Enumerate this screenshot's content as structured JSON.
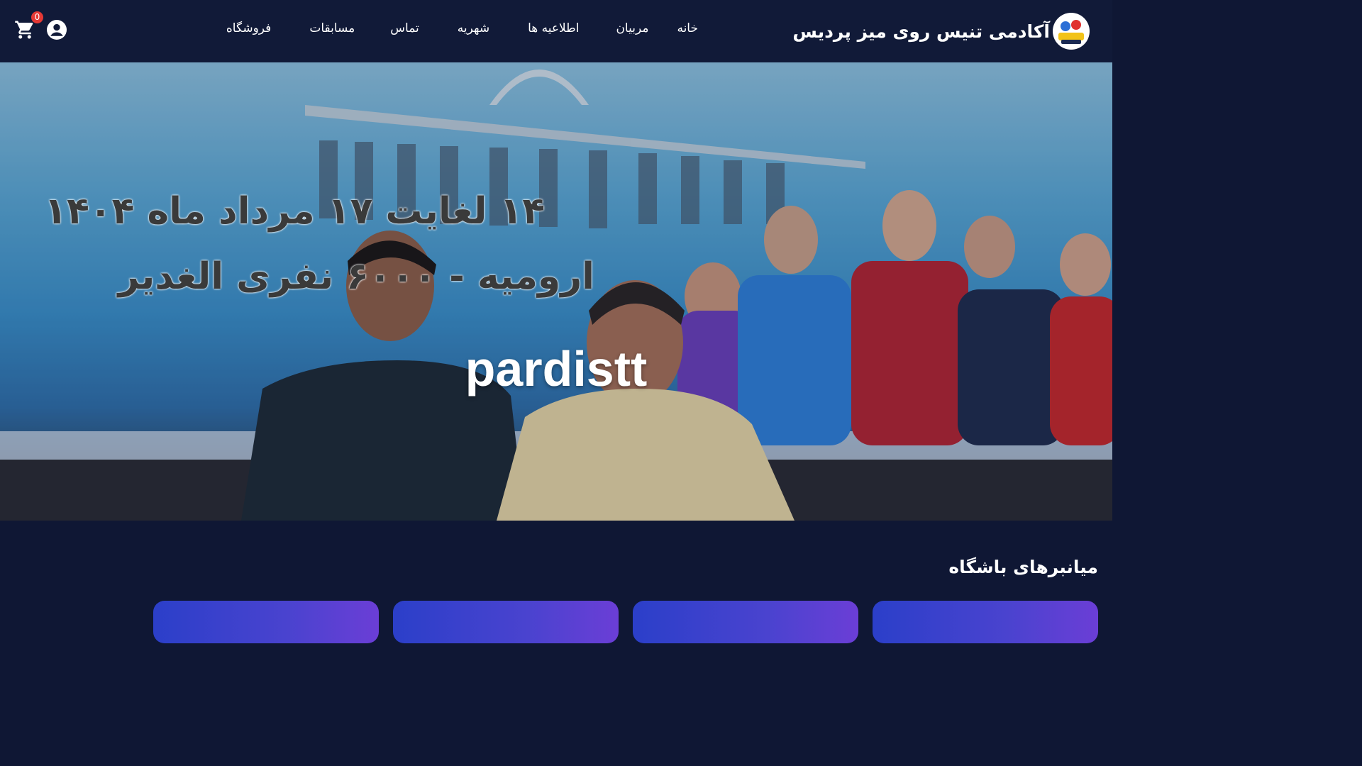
{
  "header": {
    "brand_title": "آکادمی تنیس روی میز پردیس",
    "nav": [
      "خانه",
      "مربیان",
      "اطلاعیه ها",
      "شهریه",
      "تماس",
      "مسابقات",
      "فروشگاه"
    ],
    "cart_count": "0",
    "icons": [
      "cart-icon",
      "user-icon",
      "logo-icon"
    ]
  },
  "hero": {
    "title": "pardistt",
    "banner_line1": "۱۴ لغایت ۱۷ مرداد ماه ۱۴۰۴",
    "banner_line2": "ارومیه - ۶۰۰۰ نفری الغدیر"
  },
  "section": {
    "title": "میانبرهای باشگاه"
  },
  "colors": {
    "nav_bg": "#111a38",
    "page_bg": "#0f1734",
    "card_gradient_start": "#2b3fc9",
    "card_gradient_end": "#6b3ed6",
    "badge": "#e53935"
  }
}
